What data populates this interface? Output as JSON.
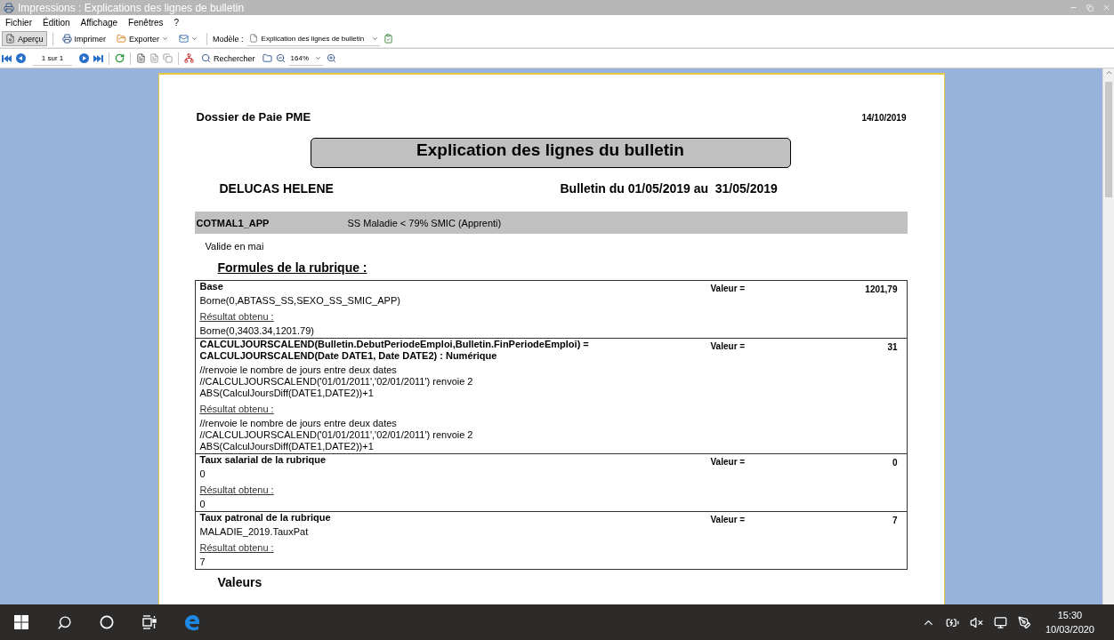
{
  "window": {
    "title": "Impressions : Explications des lignes de bulletin"
  },
  "menu": [
    "Fichier",
    "Édition",
    "Affichage",
    "Fenêtres",
    "?"
  ],
  "toolbar": {
    "preview": {
      "label": "Aperçu",
      "selected": true
    },
    "print": "Imprimer",
    "export": "Exporter",
    "model_label": "Modèle :",
    "model_value": "Explication des lignes de bulletin"
  },
  "navbar": {
    "page": "1 sur 1",
    "search": "Rechercher",
    "zoom": "164%"
  },
  "document": {
    "company": "Dossier de Paie PME",
    "date": "14/10/2019",
    "title": "Explication des lignes du bulletin",
    "employee": "DELUCAS HELENE",
    "period": "Bulletin du 01/05/2019 au  31/05/2019",
    "rubric": {
      "code": "COTMAL1_APP",
      "label": "SS Maladie < 79% SMIC (Apprenti)"
    },
    "note": "Valide en mai",
    "formulas_heading": "Formules de la rubrique :",
    "sections": [
      {
        "title": [
          "Base"
        ],
        "value_label": "Valeur =",
        "value": "1201,79",
        "formula": [
          "Borne(0,ABTASS_SS,SEXO_SS_SMIC_APP)"
        ],
        "result_label": "Résultat obtenu :",
        "result": [
          "Borne(0,3403.34,1201.79)"
        ]
      },
      {
        "title": [
          "CALCULJOURSCALEND(Bulletin.DebutPeriodeEmploi,Bulletin.FinPeriodeEmploi) =",
          "CALCULJOURSCALEND(Date DATE1, Date DATE2) : Numérique"
        ],
        "value_label": "Valeur =",
        "value": "31",
        "formula": [
          "//renvoie le nombre de jours entre deux dates",
          "//CALCULJOURSCALEND('01/01/2011','02/01/2011') renvoie 2",
          "ABS(CalculJoursDiff(DATE1,DATE2))+1"
        ],
        "result_label": "Résultat obtenu :",
        "result": [
          "//renvoie le nombre de jours entre deux dates",
          "//CALCULJOURSCALEND('01/01/2011','02/01/2011') renvoie 2",
          "ABS(CalculJoursDiff(DATE1,DATE2))+1"
        ]
      },
      {
        "title": [
          "Taux salarial de la rubrique"
        ],
        "value_label": "Valeur =",
        "value": "0",
        "formula": [
          "0"
        ],
        "result_label": "Résultat obtenu :",
        "result": [
          "0"
        ]
      },
      {
        "title": [
          "Taux patronal de la rubrique"
        ],
        "value_label": "Valeur =",
        "value": "7",
        "formula": [
          "MALADIE_2019.TauxPat"
        ],
        "result_label": "Résultat obtenu :",
        "result": [
          "7"
        ]
      }
    ],
    "next_heading": "Valeurs"
  },
  "taskbar": {
    "time": "15:30",
    "date": "10/03/2020"
  }
}
